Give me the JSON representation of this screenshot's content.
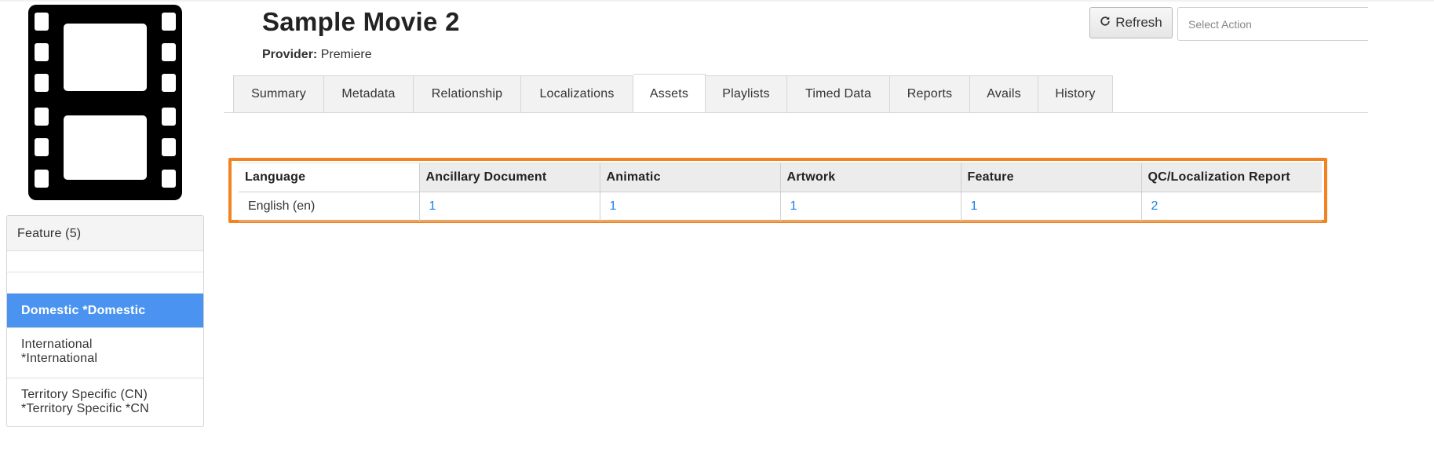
{
  "header": {
    "title": "Sample Movie 2",
    "provider_label": "Provider:",
    "provider_value": "Premiere",
    "refresh_label": "Refresh",
    "select_action_placeholder": "Select Action"
  },
  "poster": {
    "icon": "film-strip-icon"
  },
  "left_panel": {
    "header": "Feature (5)",
    "items": [
      {
        "label": "Domestic *Domestic",
        "active": true
      },
      {
        "line1": "International",
        "line2": "*International"
      },
      {
        "line1": "Territory Specific (CN)",
        "line2": "*Territory Specific *CN"
      }
    ]
  },
  "tabs": [
    {
      "label": "Summary"
    },
    {
      "label": "Metadata"
    },
    {
      "label": "Relationship"
    },
    {
      "label": "Localizations"
    },
    {
      "label": "Assets",
      "active": true
    },
    {
      "label": "Playlists"
    },
    {
      "label": "Timed Data"
    },
    {
      "label": "Reports"
    },
    {
      "label": "Avails"
    },
    {
      "label": "History"
    }
  ],
  "assets_table": {
    "columns": [
      "Language",
      "Ancillary Document",
      "Animatic",
      "Artwork",
      "Feature",
      "QC/Localization Report"
    ],
    "rows": [
      [
        "English (en)",
        "1",
        "1",
        "1",
        "1",
        "2"
      ]
    ]
  },
  "colors": {
    "active_item": "#4a93f0",
    "highlight_border": "#f08322",
    "link": "#1a7ee8"
  }
}
